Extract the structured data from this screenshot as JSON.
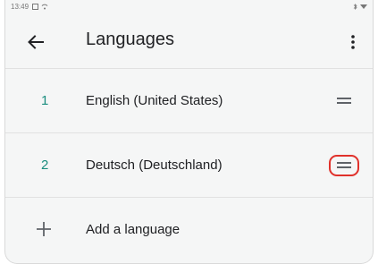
{
  "status_bar": {
    "time": "13:49"
  },
  "app_bar": {
    "title": "Languages",
    "back_icon": "arrow-back-icon",
    "menu_icon": "more-vert-icon"
  },
  "languages": [
    {
      "index": "1",
      "name": "English (United States)"
    },
    {
      "index": "2",
      "name": "Deutsch (Deutschland)"
    }
  ],
  "add_language": {
    "label": "Add a language",
    "icon": "plus-icon"
  },
  "colors": {
    "accent": "#1a8d7e",
    "highlight": "#e0312b",
    "background": "#f5f6f6"
  }
}
